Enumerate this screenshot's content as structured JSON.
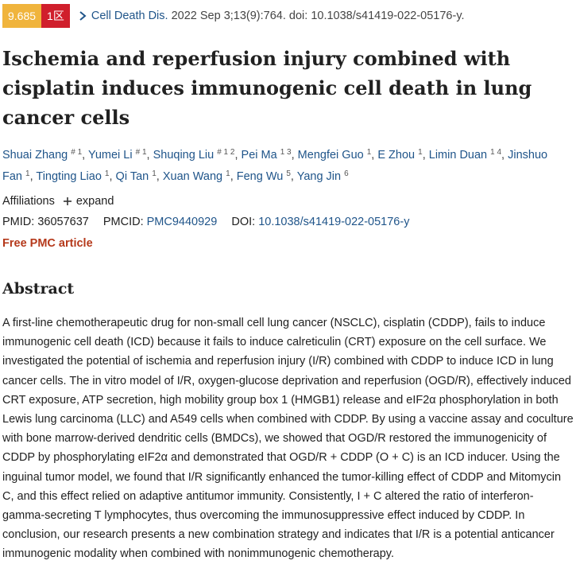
{
  "badges": {
    "impact": "9.685",
    "quartile": "1区"
  },
  "citation": {
    "journal": "Cell Death Dis.",
    "rest": " 2022 Sep 3;13(9):764. doi: 10.1038/s41419-022-05176-y."
  },
  "title": "Ischemia and reperfusion injury combined with cisplatin induces immunogenic cell death in lung cancer cells",
  "authors": [
    {
      "name": "Shuai Zhang",
      "sup": "# 1"
    },
    {
      "name": "Yumei Li",
      "sup": "# 1"
    },
    {
      "name": "Shuqing Liu",
      "sup": "# 1 2"
    },
    {
      "name": "Pei Ma",
      "sup": "1 3"
    },
    {
      "name": "Mengfei Guo",
      "sup": "1"
    },
    {
      "name": "E Zhou",
      "sup": "1"
    },
    {
      "name": "Limin Duan",
      "sup": "1 4"
    },
    {
      "name": "Jinshuo Fan",
      "sup": "1"
    },
    {
      "name": "Tingting Liao",
      "sup": "1"
    },
    {
      "name": "Qi Tan",
      "sup": "1"
    },
    {
      "name": "Xuan Wang",
      "sup": "1"
    },
    {
      "name": "Feng Wu",
      "sup": "5"
    },
    {
      "name": "Yang Jin",
      "sup": "6"
    }
  ],
  "affiliations": {
    "label": "Affiliations",
    "expand": "expand"
  },
  "ids": {
    "pmid_label": "PMID:",
    "pmid": "36057637",
    "pmcid_label": "PMCID:",
    "pmcid": "PMC9440929",
    "doi_label": "DOI:",
    "doi": "10.1038/s41419-022-05176-y"
  },
  "free_pmc": "Free PMC article",
  "abstract": {
    "heading": "Abstract",
    "text": "A first-line chemotherapeutic drug for non-small cell lung cancer (NSCLC), cisplatin (CDDP), fails to induce immunogenic cell death (ICD) because it fails to induce calreticulin (CRT) exposure on the cell surface. We investigated the potential of ischemia and reperfusion injury (I/R) combined with CDDP to induce ICD in lung cancer cells. The in vitro model of I/R, oxygen-glucose deprivation and reperfusion (OGD/R), effectively induced CRT exposure, ATP secretion, high mobility group box 1 (HMGB1) release and eIF2α phosphorylation in both Lewis lung carcinoma (LLC) and A549 cells when combined with CDDP. By using a vaccine assay and coculture with bone marrow-derived dendritic cells (BMDCs), we showed that OGD/R restored the immunogenicity of CDDP by phosphorylating eIF2α and demonstrated that OGD/R + CDDP (O + C) is an ICD inducer. Using the inguinal tumor model, we found that I/R significantly enhanced the tumor-killing effect of CDDP and Mitomycin C, and this effect relied on adaptive antitumor immunity. Consistently, I + C altered the ratio of interferon-gamma-secreting T lymphocytes, thus overcoming the immunosuppressive effect induced by CDDP. In conclusion, our research presents a new combination strategy and indicates that I/R is a potential anticancer immunogenic modality when combined with nonimmunogenic chemotherapy."
  }
}
